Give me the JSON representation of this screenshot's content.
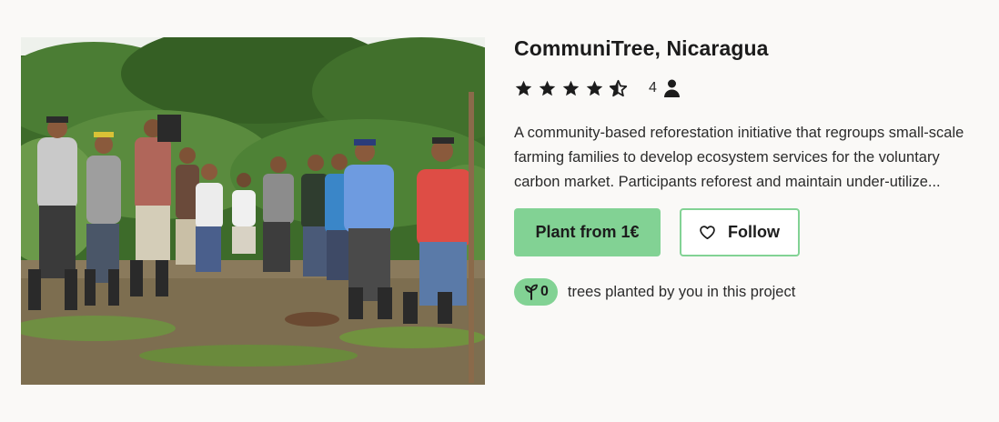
{
  "project": {
    "title": "CommuniTree, Nicaragua",
    "rating": 4.5,
    "rating_count": "4",
    "description": "A community-based reforestation initiative that regroups small-scale farming families to develop ecosystem services for the voluntary carbon market. Participants reforest and maintain under-utilize...",
    "image_alt": "Group of farmers standing in a field holding tree seedlings"
  },
  "actions": {
    "plant_label": "Plant from 1€",
    "follow_label": "Follow"
  },
  "trees": {
    "count": "0",
    "text": "trees planted by you in this project"
  },
  "icons": {
    "star": "star-icon",
    "half_star": "star-half-icon",
    "person": "person-icon",
    "heart": "heart-outline-icon",
    "sprout": "tree-sprout-icon"
  },
  "colors": {
    "accent": "#82d294",
    "background": "#faf9f7",
    "text": "#1f1f1f"
  }
}
